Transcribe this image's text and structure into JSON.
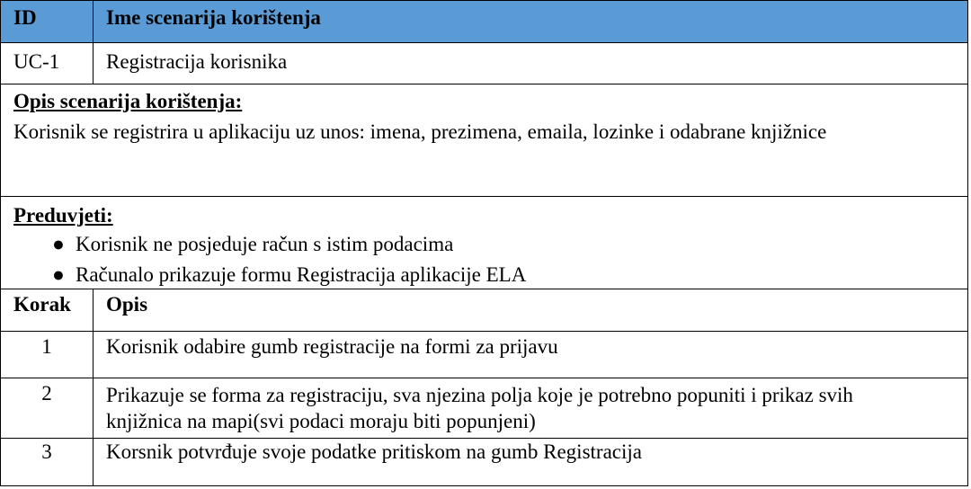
{
  "header": {
    "id_label": "ID",
    "name_label": "Ime scenarija korištenja"
  },
  "use_case": {
    "id": "UC-1",
    "name": "Registracija korisnika"
  },
  "description": {
    "title": "Opis scenarija korištenja:",
    "text": "Korisnik se registrira u aplikaciju uz unos: imena, prezimena, emaila, lozinke i odabrane knjižnice"
  },
  "preconditions": {
    "title": "Preduvjeti:",
    "items": [
      "Korisnik ne posjeduje račun s istim podacima",
      "Računalo prikazuje formu Registracija aplikacije ELA"
    ]
  },
  "steps_header": {
    "step_label": "Korak",
    "desc_label": "Opis"
  },
  "steps": [
    {
      "step": "1",
      "description": "Korisnik odabire gumb registracije na formi za prijavu"
    },
    {
      "step": "2",
      "description": "Prikazuje se forma za registraciju, sva njezina polja koje je potrebno popuniti i prikaz svih knjižnica na mapi(svi podaci moraju biti popunjeni)"
    },
    {
      "step": "3",
      "description": "Korsnik potvrđuje svoje podatke pritiskom na gumb Registracija"
    }
  ]
}
